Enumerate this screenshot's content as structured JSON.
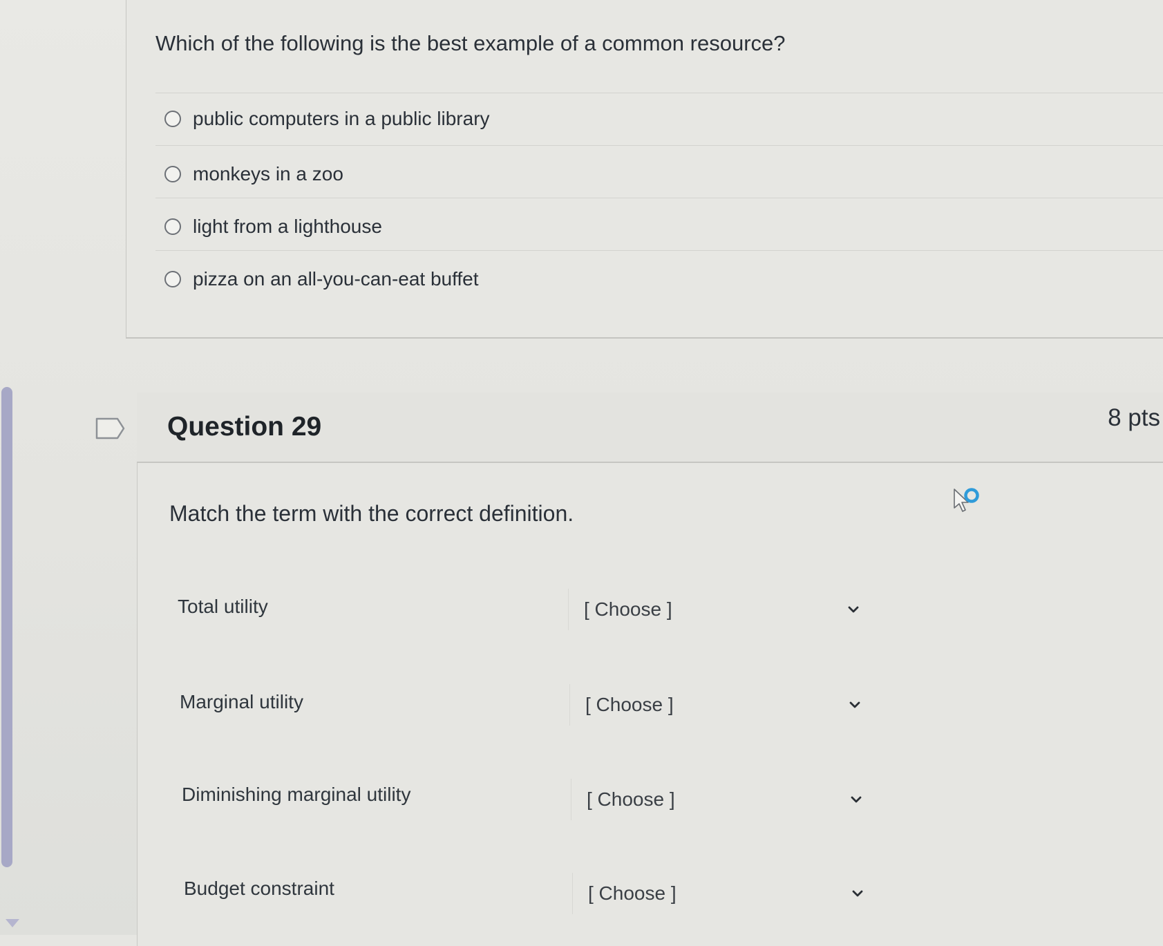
{
  "previous_question": {
    "text": "Which of the following is the best example of a common resource?",
    "options": [
      "public computers in a public library",
      "monkeys in a zoo",
      "light from a lighthouse",
      "pizza on an all-you-can-eat buffet"
    ]
  },
  "question": {
    "title": "Question 29",
    "points": "8 pts",
    "prompt": "Match the term with the correct definition.",
    "matches": [
      {
        "term": "Total utility",
        "selected": "[ Choose ]"
      },
      {
        "term": "Marginal utility",
        "selected": "[ Choose ]"
      },
      {
        "term": "Diminishing marginal utility",
        "selected": "[ Choose ]"
      },
      {
        "term": "Budget constraint",
        "selected": "[ Choose ]"
      }
    ]
  },
  "icons": {
    "flag": "flag-icon",
    "radio": "radio-icon",
    "chevron": "chevron-down-icon",
    "cursor": "mouse-cursor-icon"
  },
  "colors": {
    "background": "#e6e6e2",
    "text": "#2a3038",
    "scrollbar": "#a7a8c6",
    "cursor_ring": "#2f9bd9"
  }
}
